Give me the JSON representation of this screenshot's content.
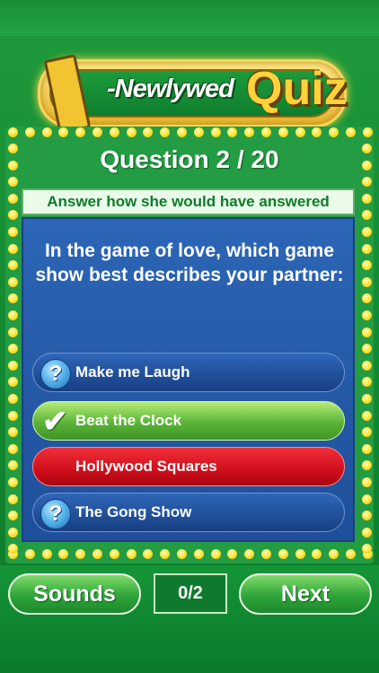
{
  "logo": {
    "prefix": "-Newlywed",
    "word": "Quiz"
  },
  "question": {
    "title": "Question 2 / 20",
    "instruction": "Answer how she would have answered",
    "text": "In the game of love, which game show best describes your partner:"
  },
  "answers": [
    {
      "label": "Make me Laugh",
      "state": "unanswered",
      "icon": "question-icon"
    },
    {
      "label": "Beat the Clock",
      "state": "correct",
      "icon": "checkmark-icon"
    },
    {
      "label": "Hollywood Squares",
      "state": "selected-wrong",
      "icon": ""
    },
    {
      "label": "The Gong Show",
      "state": "unanswered",
      "icon": "question-icon"
    }
  ],
  "icons": {
    "question_glyph": "?",
    "check_glyph": "✔"
  },
  "footer": {
    "sounds_label": "Sounds",
    "score": "0/2",
    "next_label": "Next"
  },
  "colors": {
    "background": "#138a31",
    "panel": "#2c66b6",
    "correct": "#5bb437",
    "wrong": "#cf0e1b",
    "bulb": "#ffe93a",
    "logo_gold": "#ffd23a"
  }
}
